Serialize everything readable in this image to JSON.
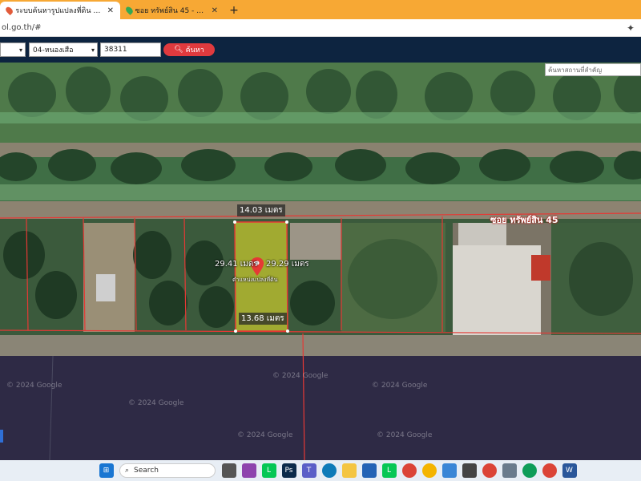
{
  "browser": {
    "tabs": [
      {
        "title": "ระบบค้นหารูปแปลงที่ดิน (LandsMap",
        "color": "#e25b3a",
        "active": true
      },
      {
        "title": "ซอย ทรัพย์สิน 45 - Google Maps",
        "color": "#34a853",
        "active": false
      }
    ],
    "url": "ol.go.th/#"
  },
  "toolbar": {
    "district": "04-หนองเสือ",
    "parcel_no": "38311",
    "search_label": "ค้นหา"
  },
  "map": {
    "place_search_placeholder": "ค้นหาสถานที่สำคัญ",
    "top_width": "14.03 เมตร",
    "bottom_width": "13.68 เมตร",
    "left_length": "29.41 เมตร",
    "right_length": "29.29 เมตร",
    "parcel_label": "ตำแหน่งแปลงที่ดิน",
    "road_label": "ซอย ทรัพย์สิน 45",
    "watermarks": [
      "© 2024 Google",
      "© 2024 Google",
      "© 2024 Google",
      "© 2024 Google",
      "© 2024 Google",
      "© 2024 Google"
    ]
  },
  "taskbar": {
    "search_label": "Search",
    "icons": [
      "windows-icon",
      "widgets-icon",
      "file-explorer-icon",
      "copilot-icon",
      "line-icon",
      "photoshop-icon",
      "teams-icon",
      "edge-icon",
      "folder-icon",
      "remote-desktop-icon",
      "line-icon",
      "store-icon",
      "chrome-icon",
      "chrome-icon",
      "calculator-icon",
      "chrome-icon",
      "notepad-icon",
      "chrome-icon",
      "chrome-icon",
      "word-icon"
    ]
  },
  "colors": {
    "tab_bar": "#f7a834",
    "toolbar": "#0d2440",
    "search_button": "#e03a3e",
    "parcel_fill": "#e6e02a",
    "parcel_border": "#e53935"
  }
}
